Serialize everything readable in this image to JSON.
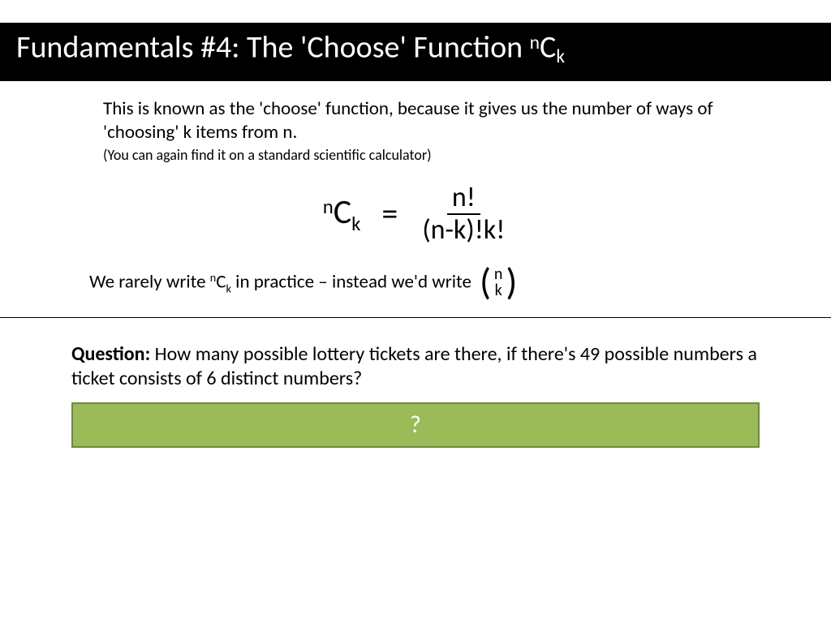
{
  "title": {
    "prefix": "Fundamentals #4: The 'Choose' Function ",
    "sup": "n",
    "big": "C",
    "sub": "k"
  },
  "intro": {
    "line1": "This is known as the 'choose' function, because it gives us the number of ways of 'choosing' k items from n.",
    "note": "(You can again find it on a standard scientific calculator)"
  },
  "formula": {
    "lhs_sup": "n",
    "lhs_big": "C",
    "lhs_sub": "k",
    "eq": "=",
    "num": "n!",
    "den": "(n-k)!k!"
  },
  "practice": {
    "pre": "We rarely write ",
    "sup": "n",
    "big": "C",
    "sub": "k",
    "post": " in practice – instead we'd write",
    "binom_top": "n",
    "binom_bot": "k"
  },
  "question": {
    "label": "Question:",
    "text": " How many possible lottery tickets are there, if there's 49 possible numbers a ticket consists of 6 distinct numbers?"
  },
  "answer": {
    "placeholder": "?"
  },
  "colors": {
    "answer_bg": "#9bbb59",
    "answer_border": "#71893f"
  }
}
